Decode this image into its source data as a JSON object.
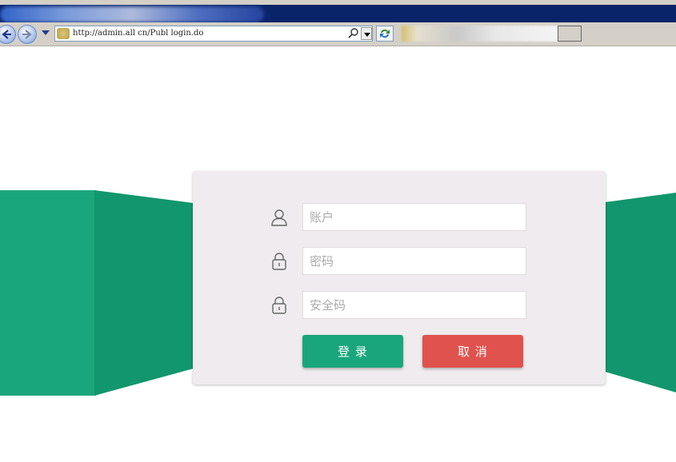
{
  "browser": {
    "address_url": "http://admin.all   cn/Publ  login.do"
  },
  "login": {
    "account_placeholder": "账户",
    "password_placeholder": "密码",
    "security_code_placeholder": "安全码",
    "login_label": "登  录",
    "cancel_label": "取  消"
  },
  "colors": {
    "accent_green": "#1aa67c",
    "cancel_red": "#e0524d",
    "card_bg": "#efebee"
  }
}
